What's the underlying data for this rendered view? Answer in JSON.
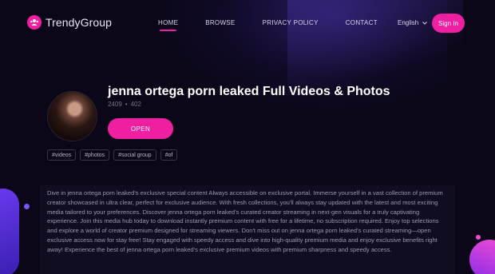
{
  "brand": {
    "name": "TrendyGroup",
    "accent": "#ee1fa0"
  },
  "nav": {
    "items": [
      {
        "label": "HOME",
        "active": true
      },
      {
        "label": "BROWSE",
        "active": false
      },
      {
        "label": "PRIVACY POLICY",
        "active": false
      },
      {
        "label": "CONTACT",
        "active": false
      }
    ]
  },
  "header": {
    "language": "English",
    "sign_in_label": "Sign In"
  },
  "profile": {
    "name": "jenna ortega porn leaked Full Videos & Photos",
    "stat_1": "2409",
    "stat_2": "402",
    "open_label": "OPEN",
    "tags": [
      "#videos",
      "#photos",
      "#social group",
      "#of"
    ]
  },
  "description": "Dive in jenna ortega porn leaked's exclusive special content Always accessible on exclusive portal. Immerse yourself in a vast collection of premium creator showcased in ultra clear, perfect for exclusive audience. With fresh collections, you'll always stay updated with the latest and most exciting media tailored to your preferences. Discover jenna ortega porn leaked's curated creator streaming in next-gen visuals for a truly captivating experience. Join this media hub today to download instantly premium content with free for a lifetime, no subscription required. Enjoy top selections and explore a world of creator premium designed for streaming viewers. Don't miss out on jenna ortega porn leaked's curated streaming—open exclusive access now for stay free! Stay engaged with speedy access and dive into high-quality premium media and enjoy exclusive benefits right away! Experience the best of jenna ortega porn leaked's exclusive premium videos with premium sharpness and speedy access."
}
